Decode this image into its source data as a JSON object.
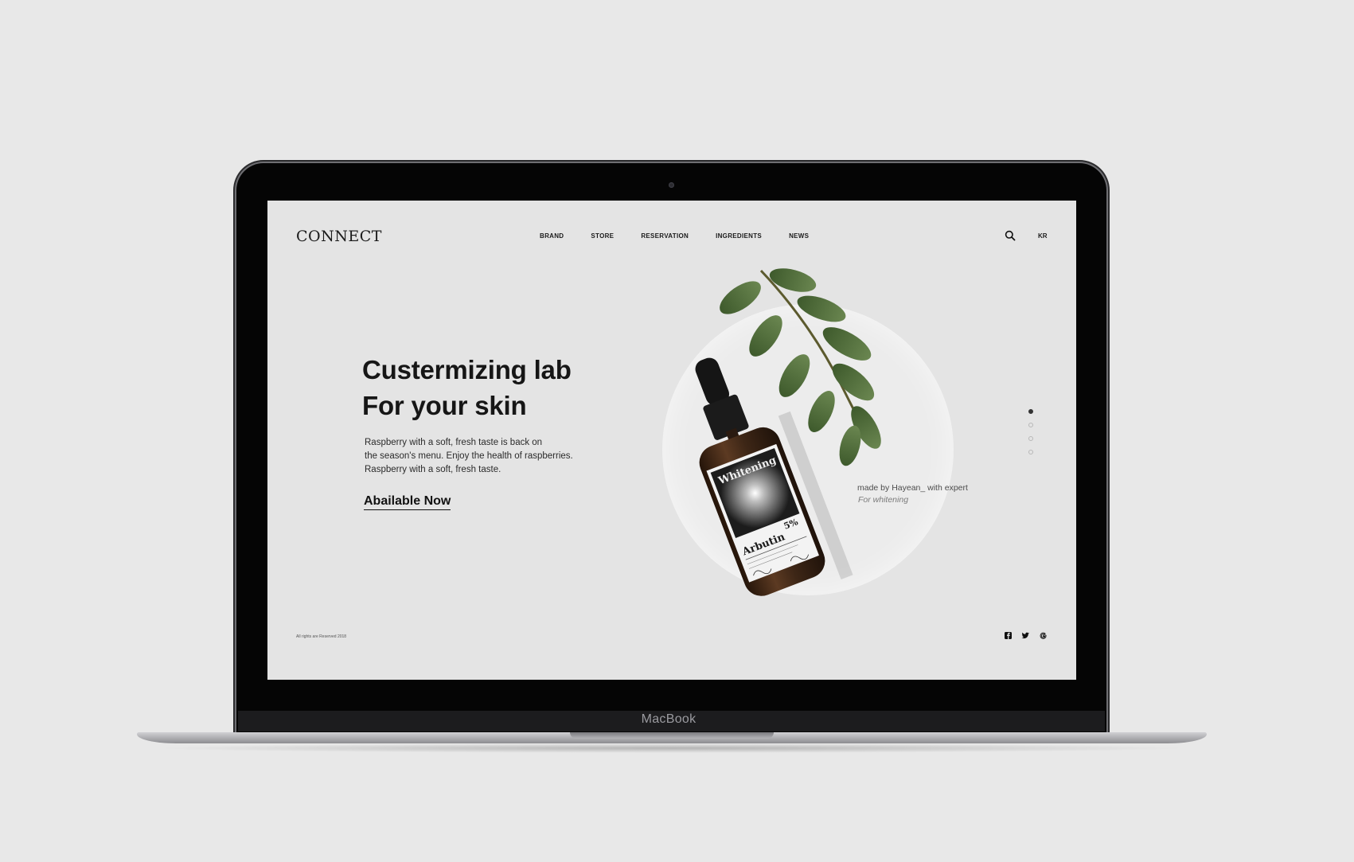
{
  "device": {
    "label": "MacBook"
  },
  "site": {
    "logo": "CONNECT",
    "nav": [
      {
        "label": "BRAND"
      },
      {
        "label": "STORE"
      },
      {
        "label": "RESERVATION"
      },
      {
        "label": "INGREDIENTS"
      },
      {
        "label": "NEWS"
      }
    ],
    "language": "KR",
    "icons": {
      "search": "search-icon",
      "social": [
        "facebook-icon",
        "twitter-icon",
        "google-icon"
      ]
    }
  },
  "hero": {
    "title_line1": "Custermizing lab",
    "title_line2": "For your skin",
    "desc_line1": "Raspberry with a soft, fresh taste is back on",
    "desc_line2": "the season's menu. Enjoy the health of raspberries.",
    "desc_line3": "Raspberry with a soft, fresh taste.",
    "cta": "Abailable Now",
    "maker": "made by Hayean_ with expert",
    "purpose": "For whitening"
  },
  "product_label": {
    "name": "Whitening",
    "ingredient": "Arbutin",
    "percent": "5%"
  },
  "pagination": {
    "count": 4,
    "active_index": 0
  },
  "footer": {
    "copyright": "All rights are Reserved 2018"
  },
  "colors": {
    "page_background": "#e8e8e8",
    "screen_background": "#e4e4e4",
    "text_primary": "#161616",
    "leaf_green": "#4f6b3a",
    "bottle_amber": "#3a2417"
  }
}
